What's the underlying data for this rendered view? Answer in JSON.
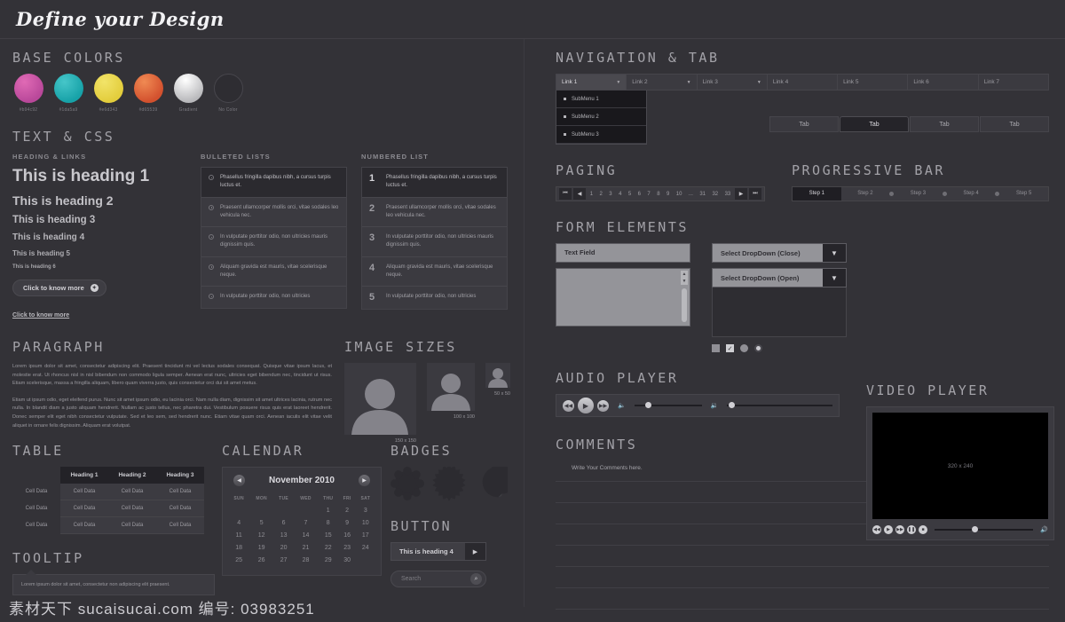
{
  "header": {
    "logo": "Define your Design"
  },
  "base_colors": {
    "title": "BASE COLORS",
    "swatches": [
      {
        "label": "#b94c92",
        "hex": "#b94c92",
        "name": "pink"
      },
      {
        "label": "#1da5a9",
        "hex": "#1da5a9",
        "name": "teal"
      },
      {
        "label": "#e6d343",
        "hex": "#e6d343",
        "name": "yellow"
      },
      {
        "label": "#d65539",
        "hex": "#d65539",
        "name": "orange"
      },
      {
        "label": "Gradient",
        "hex": "#cccccc",
        "name": "gradient"
      },
      {
        "label": "No Color",
        "hex": "#2e2d32",
        "name": "no-color"
      }
    ]
  },
  "text_css": {
    "title": "TEXT & CSS",
    "heading_links_label": "HEADING & LINKS",
    "h1": "This is heading 1",
    "h2": "This is heading 2",
    "h3": "This is heading 3",
    "h4": "This is heading 4",
    "h5": "This is heading 5",
    "h6": "This is heading 6",
    "button_label": "Click to know more",
    "button_icon": "gear-icon",
    "link_label": "Click to know more",
    "bulleted_label": "BULLETED LISTS",
    "numbered_label": "NUMBERED LIST",
    "items": [
      "Phasellus fringilla dapibus nibh, a cursus turpis luctus et.",
      "Praesent ullamcorper mollis orci, vitae sodales leo vehicula nec.",
      "In vulputate porttitor odio, non ultricies mauris dignissim quis.",
      "Aliquam gravida est mauris, vitae scelerisque neque.",
      "In vulputate porttitor odio, non ultricies"
    ],
    "numbers": [
      "1",
      "2",
      "3",
      "4",
      "5"
    ]
  },
  "paragraph": {
    "title": "PARAGRAPH",
    "p1": "Lorem ipsum dolor sit amet, consectetur adipiscing elit. Praesent tincidunt mi vel lectus sodales consequat. Quisque vitae ipsum lacus, et molestie erat. Ut rhoncus nisl in nisl bibendum non commodo ligula semper. Aenean erat nunc, ultricies eget bibendum nec, tincidunt ut risus. Etiam scelerisque, massa a fringilla aliquam, libero quam viverra justo, quis consectetur orci dui sit amet metus.",
    "p2": "Etiam ut ipsum odio, eget eleifend purus. Nunc sit amet ipsum odio, eu lacinia orci. Nam nulla diam, dignissim sit amet ultrices lacinia, rutrum nec nulla. In blandit diam a justo aliquam hendrerit. Nullam ac justo tellus, nec pharetra dui. Vestibulum posuere risus quis erat laoreet hendrerit. Donec semper elit eget nibh consectetur vulputate. Sed et leo sem, sed hendrerit nunc. Etiam vitae quam orci. Aenean iaculis elit vitae velit aliquet in ornare felis dignissim. Aliquam erat volutpat."
  },
  "image_sizes": {
    "title": "IMAGE SIZES",
    "items": [
      {
        "caption": "150 x 150"
      },
      {
        "caption": "100 x 100"
      },
      {
        "caption": "50 x 50"
      }
    ]
  },
  "table": {
    "title": "TABLE",
    "headers": [
      "",
      "Heading 1",
      "Heading 2",
      "Heading 3"
    ],
    "rows": [
      [
        "Cell Data",
        "Cell Data",
        "Cell Data",
        "Cell Data"
      ],
      [
        "Cell Data",
        "Cell Data",
        "Cell Data",
        "Cell Data"
      ],
      [
        "Cell Data",
        "Cell Data",
        "Cell Data",
        "Cell Data"
      ]
    ]
  },
  "tooltip": {
    "title": "TOOLTIP",
    "text": "Lorem ipsum dolor sit amet, consectetur non adipiscing elit praesent."
  },
  "calendar": {
    "title": "CALENDAR",
    "month": "November 2010",
    "prev_icon": "chevron-left-icon",
    "next_icon": "chevron-right-icon",
    "weekdays": [
      "SUN",
      "MON",
      "TUE",
      "WED",
      "THU",
      "FRI",
      "SAT"
    ],
    "weeks": [
      [
        "",
        "",
        "",
        "",
        "1",
        "2",
        "3"
      ],
      [
        "4",
        "5",
        "6",
        "7",
        "8",
        "9",
        "10"
      ],
      [
        "11",
        "12",
        "13",
        "14",
        "15",
        "16",
        "17"
      ],
      [
        "18",
        "19",
        "20",
        "21",
        "22",
        "23",
        "24"
      ],
      [
        "25",
        "26",
        "27",
        "28",
        "29",
        "30",
        ""
      ]
    ]
  },
  "badges": {
    "title": "BADGES",
    "shapes": [
      "scalloped",
      "starburst",
      "folded-corner"
    ]
  },
  "button": {
    "title": "BUTTON",
    "label": "This is heading 4",
    "arrow_icon": "play-arrow-icon",
    "search_placeholder": "Search",
    "search_icon": "search-icon"
  },
  "navigation": {
    "title": "NAVIGATION & TAB",
    "links": [
      {
        "label": "Link 1",
        "has_caret": true,
        "active": true
      },
      {
        "label": "Link 2",
        "has_caret": true,
        "active": false
      },
      {
        "label": "Link 3",
        "has_caret": true,
        "active": false
      },
      {
        "label": "Link 4",
        "has_caret": false,
        "active": false
      },
      {
        "label": "Link 5",
        "has_caret": false,
        "active": false
      },
      {
        "label": "Link 6",
        "has_caret": false,
        "active": false
      },
      {
        "label": "Link 7",
        "has_caret": false,
        "active": false
      }
    ],
    "submenu": [
      "SubMenu 1",
      "SubMenu 2",
      "SubMenu 3"
    ],
    "tabs": [
      {
        "label": "Tab",
        "active": false
      },
      {
        "label": "Tab",
        "active": true
      },
      {
        "label": "Tab",
        "active": false
      },
      {
        "label": "Tab",
        "active": false
      }
    ]
  },
  "paging": {
    "title": "PAGING",
    "first_icon": "double-chevron-left-icon",
    "prev_icon": "chevron-left-icon",
    "next_icon": "chevron-right-icon",
    "last_icon": "double-chevron-right-icon",
    "pages": [
      "1",
      "2",
      "3",
      "4",
      "5",
      "6",
      "7",
      "8",
      "9",
      "10",
      "...",
      "31",
      "32",
      "33"
    ]
  },
  "progressive_bar": {
    "title": "PROGRESSIVE BAR",
    "steps": [
      {
        "label": "Step 1",
        "active": true
      },
      {
        "label": "Step 2",
        "active": false
      },
      {
        "label": "Step 3",
        "active": false
      },
      {
        "label": "Step 4",
        "active": false
      },
      {
        "label": "Step 5",
        "active": false
      }
    ]
  },
  "form": {
    "title": "FORM ELEMENTS",
    "text_field_value": "Text Field",
    "select_closed": "Select DropDown (Close)",
    "select_open": "Select DropDown (Open)",
    "checkbox_unchecked": "",
    "checkbox_checked": "✓",
    "radio_unselected": "",
    "radio_selected": ""
  },
  "video": {
    "title": "VIDEO PLAYER",
    "placeholder": "320 x 240",
    "controls": [
      "rewind-icon",
      "play-icon",
      "forward-icon",
      "pause-icon",
      "stop-icon"
    ],
    "volume_icon": "volume-icon"
  },
  "audio": {
    "title": "AUDIO PLAYER",
    "controls": [
      "rewind-icon",
      "play-icon",
      "forward-icon"
    ],
    "volume_low_icon": "volume-low-icon",
    "volume_high_icon": "volume-high-icon"
  },
  "comments": {
    "title": "COMMENTS",
    "placeholder": "Write Your Comments here.",
    "line_count": 7
  },
  "watermark": {
    "text": "素材天下 sucaisucai.com 编号: 03983251"
  }
}
